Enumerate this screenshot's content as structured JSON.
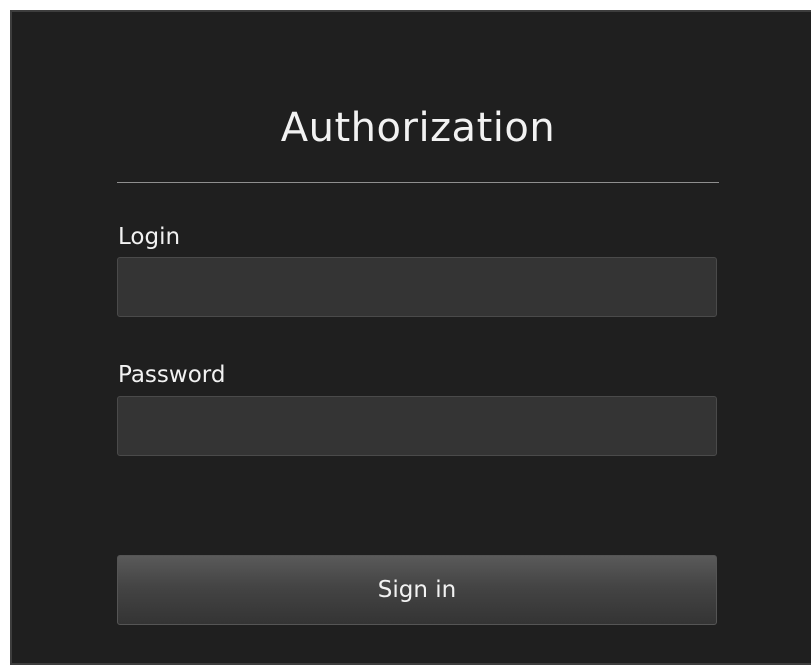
{
  "form": {
    "title": "Authorization",
    "login": {
      "label": "Login",
      "value": "",
      "placeholder": ""
    },
    "password": {
      "label": "Password",
      "value": "",
      "placeholder": ""
    },
    "submit_label": "Sign in"
  },
  "colors": {
    "panel_background": "#1f1f1f",
    "input_background": "#343434",
    "text": "#f2f2f2",
    "divider": "#8f8f8f"
  }
}
